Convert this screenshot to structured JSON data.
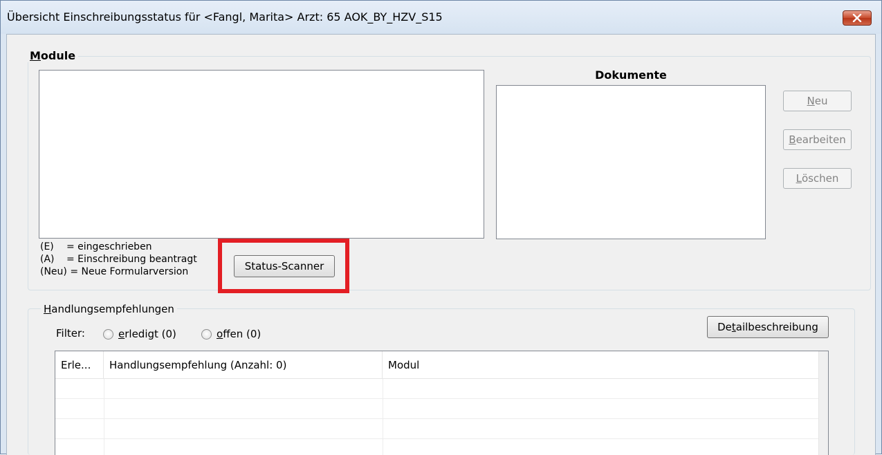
{
  "window": {
    "title": "Übersicht Einschreibungsstatus für <Fangl, Marita> Arzt: 65 AOK_BY_HZV_S15",
    "close_icon": "close-icon"
  },
  "module": {
    "group_label_accel": "M",
    "group_label_rest": "odule",
    "documents_heading": "Dokumente",
    "legend": [
      {
        "code": "(E)",
        "text": "= eingeschrieben"
      },
      {
        "code": "(A)",
        "text": "= Einschreibung beantragt"
      },
      {
        "code": "(Neu)",
        "text": "= Neue Formularversion"
      }
    ],
    "status_scanner_label": "Status-Scanner"
  },
  "doc_buttons": {
    "new": {
      "accel": "N",
      "rest": "eu"
    },
    "edit": {
      "accel": "B",
      "rest": "earbeiten"
    },
    "delete": {
      "accel": "L",
      "rest": "öschen"
    }
  },
  "recommendations": {
    "group_label_accel": "H",
    "group_label_rest": "andlungsempfehlungen",
    "filter_label": "Filter:",
    "filter_done": {
      "accel": "e",
      "rest": "rledigt (0)"
    },
    "filter_open": {
      "accel": "o",
      "rest": "ffen (0)"
    },
    "detail_button": {
      "pre": "De",
      "accel": "t",
      "rest": "ailbeschreibung"
    },
    "columns": [
      "Erle...",
      "Handlungsempfehlung (Anzahl: 0)",
      "Modul"
    ]
  },
  "colors": {
    "highlight": "#e31e24",
    "close_button": "#c84b2c"
  }
}
